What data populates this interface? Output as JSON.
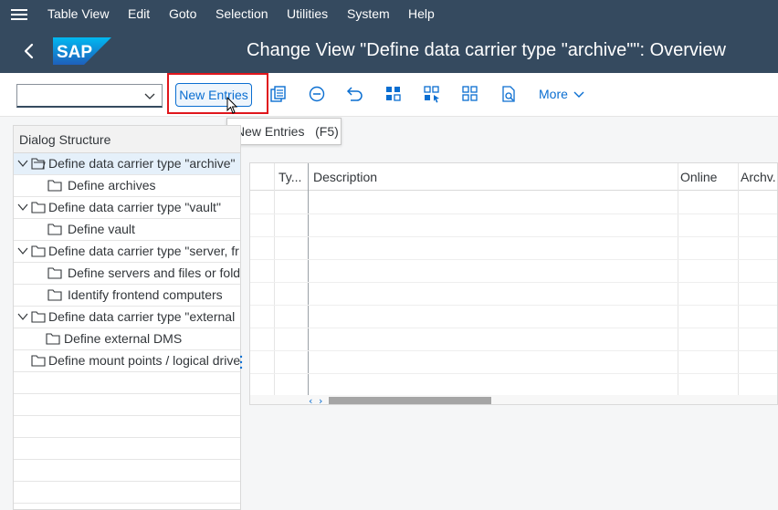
{
  "menu": {
    "items": [
      "Table View",
      "Edit",
      "Goto",
      "Selection",
      "Utilities",
      "System",
      "Help"
    ]
  },
  "header": {
    "logo_text": "SAP",
    "title": "Change View \"Define data carrier type \"archive\"\": Overview"
  },
  "toolbar": {
    "combo_value": "",
    "new_entries_label": "New Entries",
    "more_label": "More",
    "icons": [
      "copy-as-icon",
      "delete-icon",
      "undo-change-icon",
      "select-all-icon",
      "select-block-icon",
      "deselect-all-icon",
      "print-preview-icon"
    ]
  },
  "tooltip": {
    "text": "New Entries   (F5)"
  },
  "dialog_structure": {
    "title": "Dialog Structure",
    "items": [
      {
        "label": "Define data carrier type \"archive\"",
        "level": 0,
        "expanded": true,
        "selected": true
      },
      {
        "label": "Define archives",
        "level": 1
      },
      {
        "label": "Define data carrier type \"vault\"",
        "level": 0,
        "expanded": true
      },
      {
        "label": "Define vault",
        "level": 1
      },
      {
        "label": "Define data carrier type \"server, fr",
        "level": 0,
        "expanded": true
      },
      {
        "label": "Define servers and files or fold",
        "level": 1
      },
      {
        "label": "Identify frontend computers",
        "level": 1
      },
      {
        "label": "Define data carrier type \"external",
        "level": 0,
        "expanded": true
      },
      {
        "label": "Define external DMS",
        "level": 1
      },
      {
        "label": "Define mount points / logical drive",
        "level": 0
      }
    ]
  },
  "table": {
    "columns": [
      "Ty...",
      "Description",
      "Online",
      "Archv."
    ],
    "rows": []
  },
  "colors": {
    "shell": "#354a5f",
    "accent": "#0a6ed1",
    "highlight": "#e0161c"
  }
}
